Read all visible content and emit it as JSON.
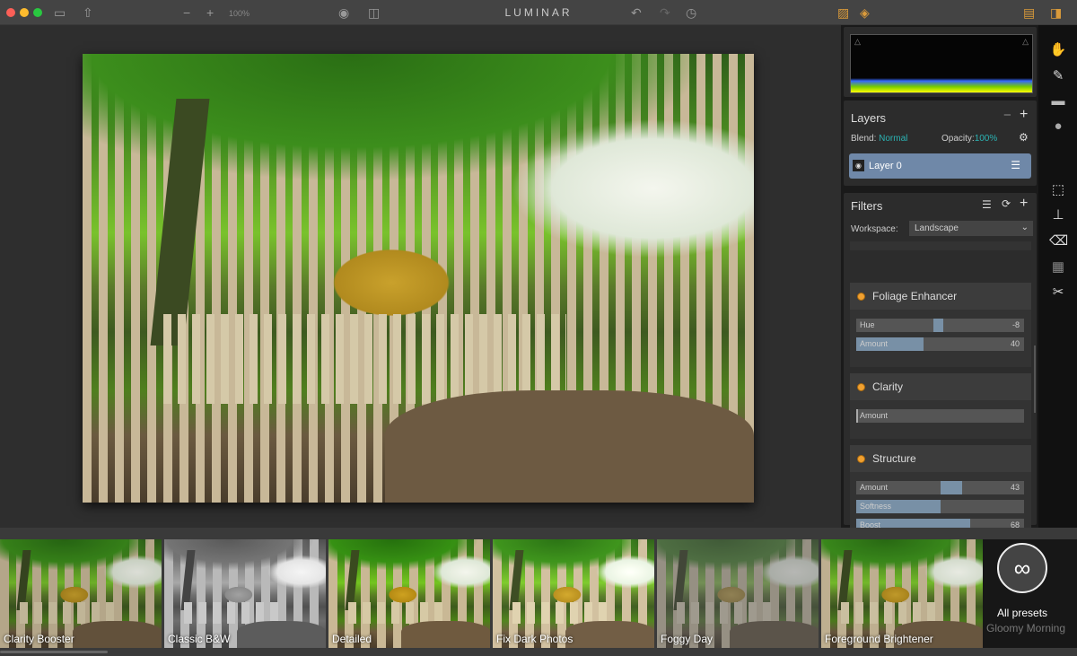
{
  "app": {
    "title": "LUMINAR",
    "zoom": "100%"
  },
  "toolbar": {
    "icons": [
      "folder-icon",
      "share-icon",
      "zoom-out-icon",
      "zoom-in-icon",
      "eye-icon",
      "compare-icon",
      "undo-icon",
      "redo-icon",
      "history-icon",
      "image-icon",
      "layers-icon",
      "filmstrip-layout-icon",
      "sidebar-layout-icon"
    ]
  },
  "layers": {
    "title": "Layers",
    "blend_label": "Blend:",
    "blend_value": "Normal",
    "opacity_label": "Opacity:",
    "opacity_value": "100%",
    "layer_name": "Layer 0"
  },
  "filters": {
    "title": "Filters",
    "workspace_label": "Workspace:",
    "workspace_value": "Landscape",
    "cards": [
      {
        "name": "Foliage Enhancer",
        "sliders": [
          {
            "label": "Hue",
            "value": "-8",
            "fill": -0.08
          },
          {
            "label": "Amount",
            "value": "40",
            "fill": 0.4
          }
        ]
      },
      {
        "name": "Clarity",
        "sliders": [
          {
            "label": "Amount",
            "value": "",
            "fill": 0
          }
        ]
      },
      {
        "name": "Structure",
        "sliders": [
          {
            "label": "Amount",
            "value": "43",
            "fill": 0.43
          },
          {
            "label": "Softness",
            "value": "",
            "fill": 0.5
          },
          {
            "label": "Boost",
            "value": "68",
            "fill": 0.68
          }
        ]
      }
    ]
  },
  "colors": {
    "accent": "#d99a3a",
    "teal": "#2bb3b3",
    "layer_selected": "#6f88a8",
    "filter_dot": "#f0a030"
  },
  "presets": [
    "Clarity Booster",
    "Classic B&W",
    "Detailed",
    "Fix Dark Photos",
    "Foggy Day",
    "Foreground Brightener"
  ],
  "all_presets": {
    "label": "All presets",
    "next": "Gloomy Morning"
  }
}
